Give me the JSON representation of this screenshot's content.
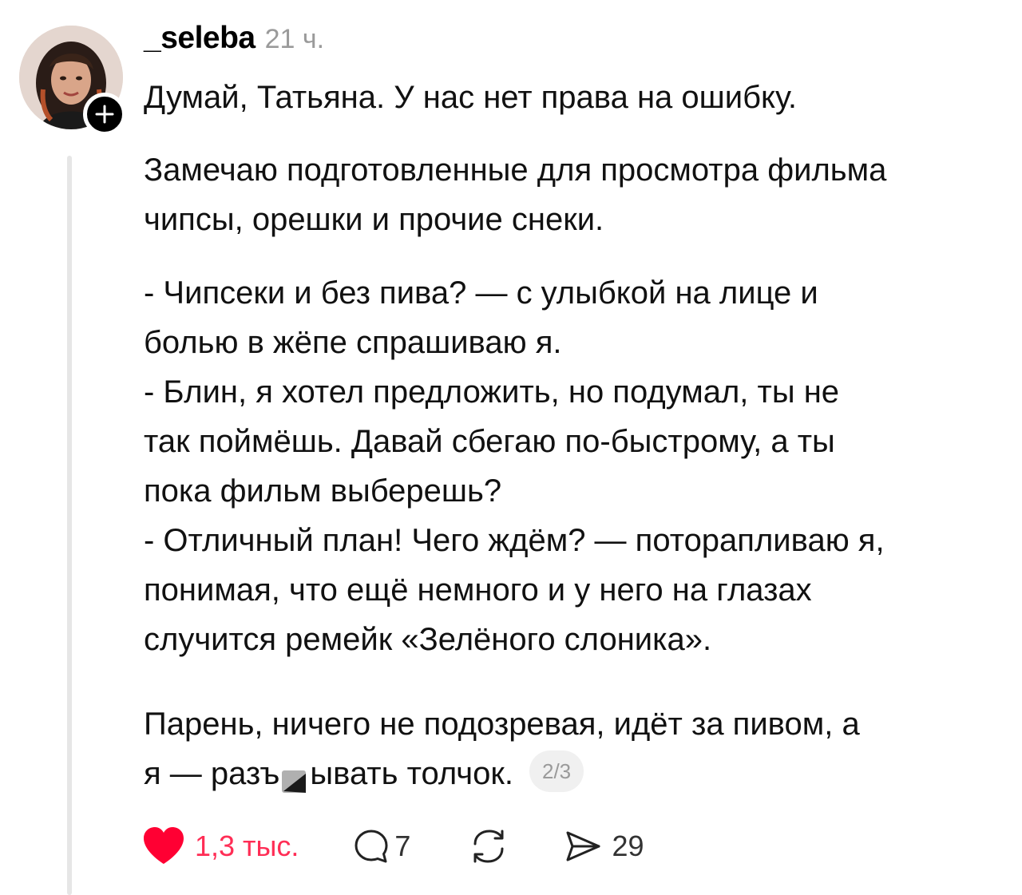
{
  "post": {
    "username": "_seleba",
    "time": "21 ч.",
    "first_line": "Думай, Татьяна. У нас нет права на ошибку.",
    "paragraph2": [
      "Замечаю подготовленные для просмотра фильма",
      "чипсы, орешки и прочие снеки."
    ],
    "paragraph3": [
      "- Чипсеки и без пива? — с улыбкой на лице и",
      "болью в жёпе спрашиваю я.",
      "- Блин, я хотел предложить, но подумал, ты не",
      "так поймёшь. Давай сбегаю по-быстрому, а ты",
      "пока фильм выберешь?",
      "- Отличный план! Чего ждём? — поторапливаю я,",
      "понимая, что ещё немного и у него на глазах",
      "случится ремейк «Зелёного слоника»."
    ],
    "paragraph4_line1": "Парень, ничего не подозревая, идёт за пивом, а",
    "paragraph4_line2_start": "я — разъ",
    "paragraph4_line2_end": "ывать толчок.",
    "page_indicator": "2/3"
  },
  "actions": {
    "likes": "1,3 тыс.",
    "comments": "7",
    "shares": "29"
  },
  "icons": {
    "avatar": "user-avatar",
    "follow": "plus-icon",
    "like": "heart-icon",
    "comment": "speech-bubble-icon",
    "repost": "repost-icon",
    "share": "send-icon",
    "censor": "censor-emoji"
  },
  "colors": {
    "like_active": "#ff2d55",
    "text": "#111111",
    "muted": "#9a9a9a",
    "thread_line": "#e6e6e6"
  }
}
